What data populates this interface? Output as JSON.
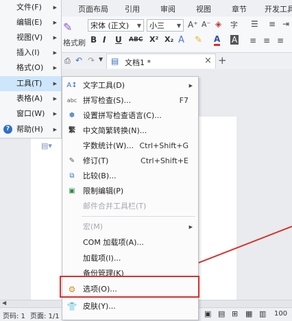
{
  "ribbon": {
    "tabs": [
      "页面布局",
      "引用",
      "审阅",
      "视图",
      "章节",
      "开发工具"
    ],
    "font_name": "宋体 (正文)",
    "font_size": "小三",
    "format_brush": "格式刷",
    "bold": "B",
    "italic": "I",
    "underline": "U",
    "strike": "ABC",
    "superscript": "X²",
    "subscript": "X₂",
    "font_color": "A"
  },
  "doc_tab": {
    "title": "文档1 *",
    "close": "×",
    "add": "+"
  },
  "main_menu": [
    {
      "label": "文件(F)"
    },
    {
      "label": "编辑(E)"
    },
    {
      "label": "视图(V)"
    },
    {
      "label": "插入(I)"
    },
    {
      "label": "格式(O)"
    },
    {
      "label": "工具(T)"
    },
    {
      "label": "表格(A)"
    },
    {
      "label": "窗口(W)"
    },
    {
      "label": "帮助(H)"
    }
  ],
  "tools_menu": [
    {
      "label": "文字工具(D)",
      "icon": "text-tool-icon",
      "shortcut": ""
    },
    {
      "label": "拼写检查(S)...",
      "icon": "spell-check-icon",
      "shortcut": "F7"
    },
    {
      "label": "设置拼写检查语言(C)...",
      "icon": "spell-lang-icon",
      "shortcut": ""
    },
    {
      "label": "中文简繁转换(N)...",
      "icon": "convert-icon",
      "shortcut": ""
    },
    {
      "label": "字数统计(W)...",
      "icon": "",
      "shortcut": "Ctrl+Shift+G"
    },
    {
      "label": "修订(T)",
      "icon": "revise-icon",
      "shortcut": "Ctrl+Shift+E"
    },
    {
      "label": "比较(B)...",
      "icon": "compare-icon",
      "shortcut": ""
    },
    {
      "label": "限制编辑(P)",
      "icon": "restrict-icon",
      "shortcut": ""
    },
    {
      "label": "邮件合并工具栏(T)",
      "icon": "",
      "shortcut": ""
    },
    {
      "label": "宏(M)",
      "icon": "",
      "shortcut": ""
    },
    {
      "label": "COM 加载项(A)...",
      "icon": "",
      "shortcut": ""
    },
    {
      "label": "加载项(I)...",
      "icon": "",
      "shortcut": ""
    },
    {
      "label": "备份管理(K)",
      "icon": "",
      "shortcut": ""
    },
    {
      "label": "选项(O)...",
      "icon": "gear-icon",
      "shortcut": ""
    },
    {
      "label": "皮肤(Y)...",
      "icon": "skin-icon",
      "shortcut": ""
    }
  ],
  "statusbar": {
    "page_num": "页码: 1",
    "page_total": "页面: 1/1",
    "zoom": "100"
  },
  "colors": {
    "highlight_box": "#d9302c",
    "selected_menu": "#cde6fb"
  }
}
